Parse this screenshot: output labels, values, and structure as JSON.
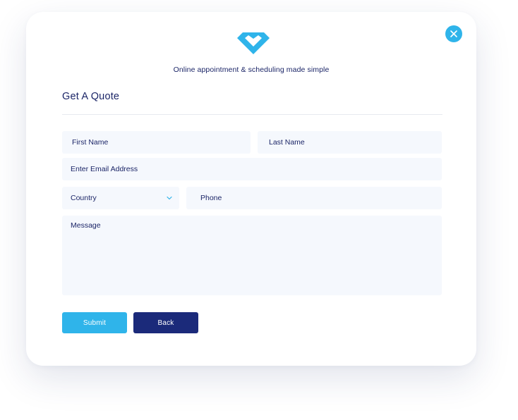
{
  "header": {
    "logo_icon": "diamond-heart-logo-icon",
    "tagline": "Online appointment &  scheduling made simple",
    "close_icon": "close-icon"
  },
  "form": {
    "title": "Get A Quote",
    "first_name_placeholder": "First Name",
    "last_name_placeholder": "Last Name",
    "email_placeholder": "Enter Email Address",
    "country_selected": "Country",
    "phone_placeholder": "Phone",
    "message_placeholder": "Message"
  },
  "buttons": {
    "submit_label": "Submit",
    "back_label": "Back"
  },
  "colors": {
    "accent": "#2fb4ea",
    "primary_dark": "#1b2a7a",
    "text_dark": "#1b2567",
    "field_bg": "#f5f8fd"
  }
}
